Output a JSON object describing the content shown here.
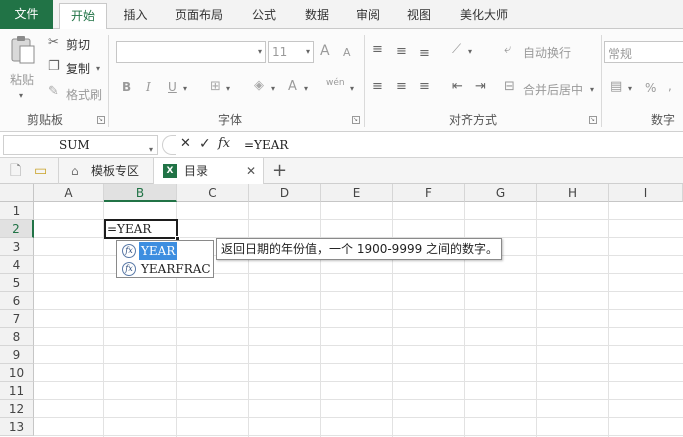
{
  "tabs": [
    "文件",
    "开始",
    "插入",
    "页面布局",
    "公式",
    "数据",
    "审阅",
    "视图",
    "美化大师"
  ],
  "active_tab_index": 1,
  "clipboard": {
    "paste": "粘贴",
    "cut": "剪切",
    "copy": "复制",
    "format_painter": "格式刷",
    "group": "剪贴板"
  },
  "font": {
    "size": "11",
    "grow": "A",
    "shrink": "A",
    "bold": "B",
    "italic": "I",
    "underline": "U",
    "font_color": "A",
    "phonetic": "wén",
    "group": "字体"
  },
  "alignment": {
    "wrap": "自动换行",
    "merge": "合并后居中",
    "group": "对齐方式"
  },
  "number": {
    "format": "常规",
    "percent": "%",
    "comma": ",",
    "group": "数字"
  },
  "formula_bar": {
    "name_box": "SUM",
    "fx": "fx",
    "cancel": "✕",
    "enter": "✓",
    "content": "=YEAR"
  },
  "doc_tabs": {
    "template_zone": "模板专区",
    "workbook": "目录",
    "close": "✕",
    "add": "+"
  },
  "columns": [
    "A",
    "B",
    "C",
    "D",
    "E",
    "F",
    "G",
    "H",
    "I"
  ],
  "rows": [
    "1",
    "2",
    "3",
    "4",
    "5",
    "6",
    "7",
    "8",
    "9",
    "10",
    "11",
    "12",
    "13"
  ],
  "selected_column": "B",
  "selected_row": "2",
  "active_cell_text": "=YEAR",
  "autocomplete": {
    "items": [
      "YEAR",
      "YEARFRAC"
    ],
    "selected_index": 0,
    "tooltip": "返回日期的年份值，一个 1900-9999 之间的数字。"
  },
  "colors": {
    "accent": "#217346",
    "selection": "#3d8ee0"
  }
}
